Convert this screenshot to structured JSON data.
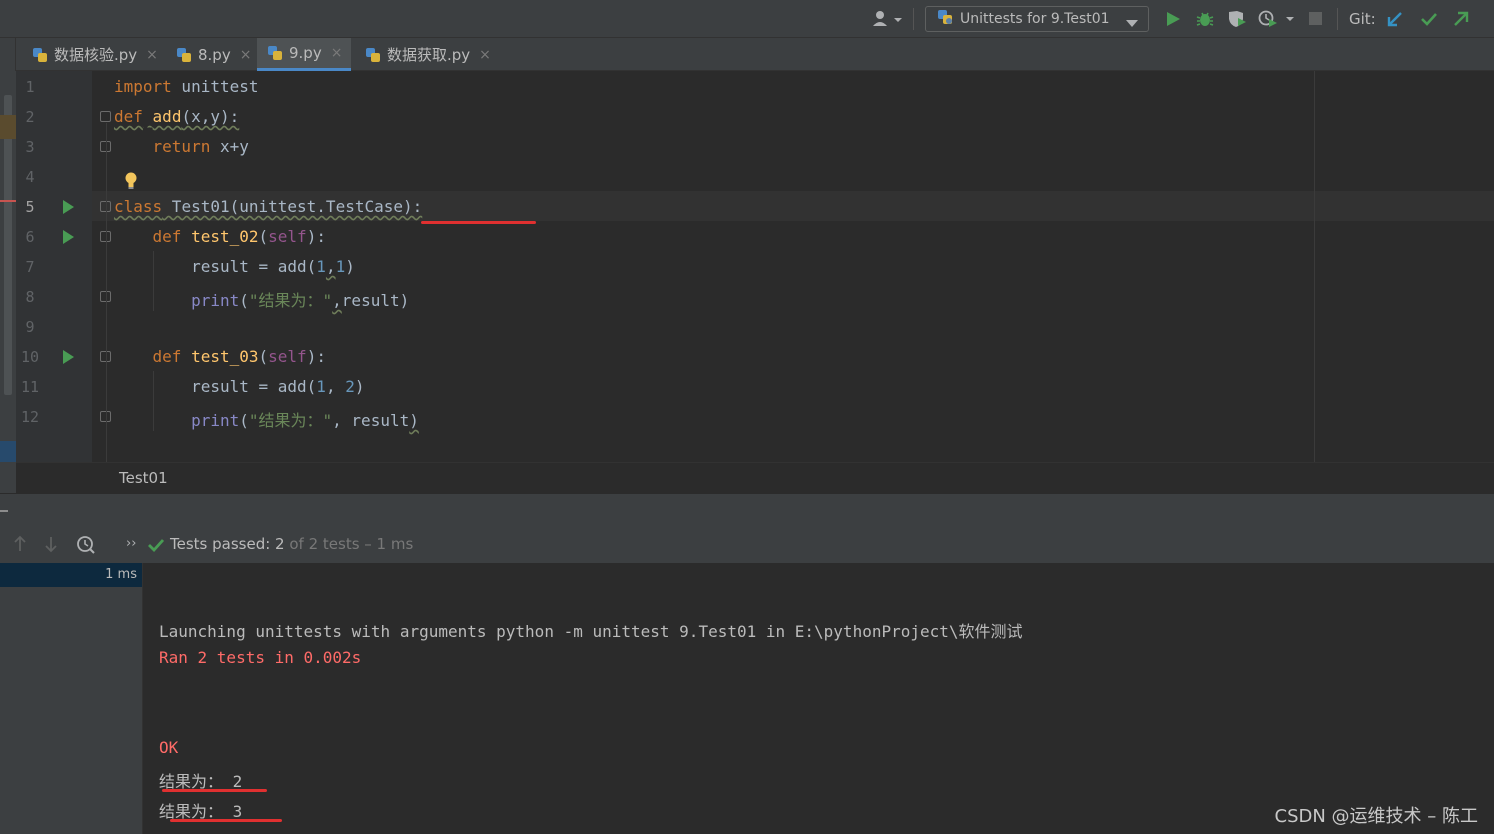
{
  "toolbar": {
    "user_icon": "user-icon",
    "run_config_label": "Unittests for 9.Test01",
    "git_label": "Git:"
  },
  "tabs": [
    {
      "label": "数据核验.py",
      "close": "×"
    },
    {
      "label": "8.py",
      "close": "×"
    },
    {
      "label": "9.py",
      "close": "×",
      "active": true
    },
    {
      "label": "数据获取.py",
      "close": "×"
    }
  ],
  "editor": {
    "line_numbers": [
      "1",
      "2",
      "3",
      "4",
      "5",
      "6",
      "7",
      "8",
      "9",
      "10",
      "11",
      "12"
    ],
    "current_line": 5
  },
  "breadcrumb": {
    "label": "Test01"
  },
  "run_panel": {
    "status_prefix": "Tests passed: ",
    "status_count": "2",
    "status_rest": " of 2 tests – 1 ms",
    "expand_glyph": "››",
    "tree_time": "1 ms"
  },
  "output": {
    "launch_line": "Launching unittests with arguments python -m unittest 9.Test01 in E:\\pythonProject\\软件测试",
    "ran_line": "Ran 2 tests in 0.002s",
    "ok_line": "OK",
    "result_line_1": "结果为： 2",
    "result_line_2": "结果为： 3"
  },
  "watermark": "CSDN @运维技术 – 陈工",
  "colors": {
    "accent": "#4a88c7",
    "run_green": "#499c54",
    "error_red": "#ff6b68",
    "annotation_red": "#e03030"
  }
}
